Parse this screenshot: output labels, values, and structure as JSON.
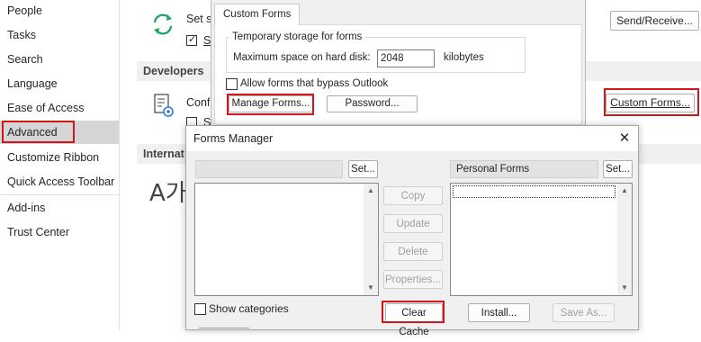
{
  "nav": {
    "items": [
      "People",
      "Tasks",
      "Search",
      "Language",
      "Ease of Access",
      "Advanced",
      "Customize Ribbon",
      "Quick Access Toolbar",
      "Add-ins",
      "Trust Center"
    ],
    "active": "Advanced"
  },
  "main": {
    "sync_text": "Set s",
    "sync_check_text": "S",
    "send_receive_label": "Send/Receive...",
    "developers_header": "Developers",
    "developers_text": "Conf",
    "developers_check_text": "S",
    "custom_forms_button": "Custom Forms...",
    "international_header": "Internat",
    "language_glyph": "A가"
  },
  "custom_forms_dialog": {
    "tab_label": "Custom Forms",
    "group_title": "Temporary storage for forms",
    "max_space_label": "Maximum space on hard disk:",
    "max_space_value": "2048",
    "unit_label": "kilobytes",
    "allow_bypass_label": "Allow forms that bypass Outlook",
    "manage_forms_label": "Manage Forms...",
    "password_label": "Password..."
  },
  "forms_manager": {
    "title": "Forms Manager",
    "close_glyph": "✕",
    "left_set_label": "Set...",
    "right_header": "Personal Forms",
    "right_set_label": "Set...",
    "copy_label": "Copy",
    "update_label": "Update",
    "delete_label": "Delete",
    "properties_label": "Properties...",
    "show_categories_label": "Show categories",
    "clear_cache_label": "Clear Cache",
    "install_label": "Install...",
    "save_as_label": "Save As..."
  },
  "colors": {
    "highlight_red": "#d4161c",
    "accent_green": "#21a366",
    "dialog_bg": "#f0f0f0"
  }
}
